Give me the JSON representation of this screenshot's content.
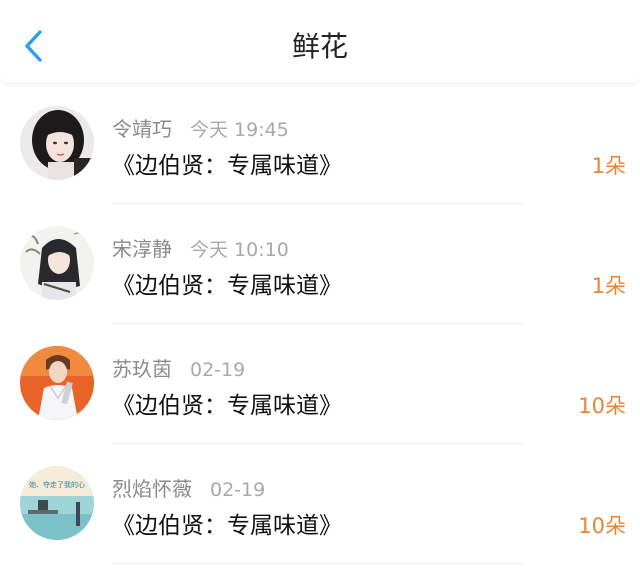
{
  "header": {
    "title": "鲜花",
    "back_icon": "chevron-left-icon",
    "accent_color": "#2b9ff0"
  },
  "items": [
    {
      "name": "令靖巧",
      "time": "今天 19:45",
      "work": "《边伯贤：专属味道》",
      "count": "1朵"
    },
    {
      "name": "宋淳静",
      "time": "今天 10:10",
      "work": "《边伯贤：专属味道》",
      "count": "1朵"
    },
    {
      "name": "苏玖茵",
      "time": "02-19",
      "work": "《边伯贤：专属味道》",
      "count": "10朵"
    },
    {
      "name": "烈焰怀薇",
      "time": "02-19",
      "work": "《边伯贤：专属味道》",
      "count": "10朵"
    }
  ],
  "avatar_caption_4": "她、夺走了我的心",
  "count_color": "#e8843a"
}
